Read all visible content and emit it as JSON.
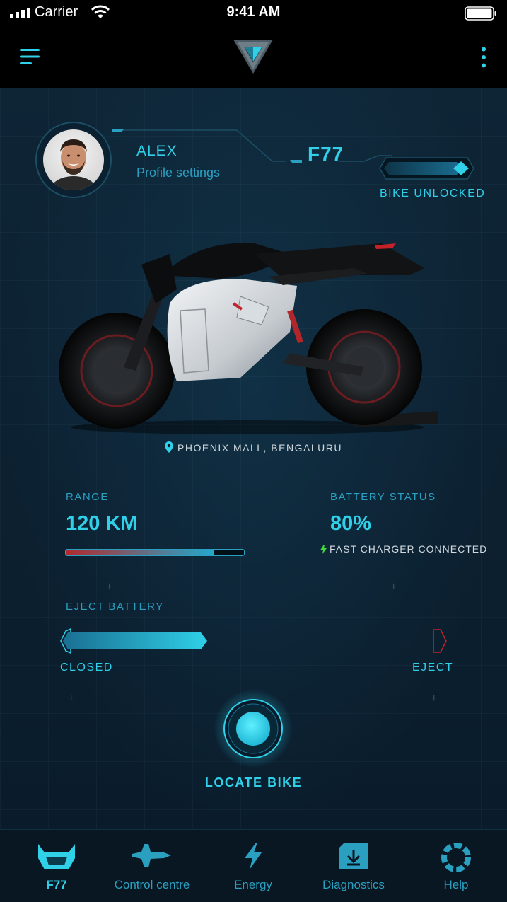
{
  "status_bar": {
    "carrier": "Carrier",
    "time": "9:41 AM"
  },
  "nav": {
    "menu_icon": "hamburger-icon",
    "logo_icon": "brand-logo",
    "more_icon": "more-vertical-icon"
  },
  "profile": {
    "name": "ALEX",
    "settings_link": "Profile settings"
  },
  "vehicle": {
    "model": "F77",
    "lock_status": "BIKE UNLOCKED",
    "lock_toggle_on": true,
    "location": "PHOENIX MALL, BENGALURU"
  },
  "range": {
    "label": "RANGE",
    "value": "120 KM",
    "fill_fraction": 0.83
  },
  "battery": {
    "label": "BATTERY STATUS",
    "value": "80%",
    "charger_status": "FAST CHARGER CONNECTED"
  },
  "eject": {
    "label": "EJECT BATTERY",
    "closed_label": "CLOSED",
    "eject_label": "EJECT"
  },
  "locate": {
    "label": "LOCATE BIKE"
  },
  "tabs": [
    {
      "label": "F77",
      "icon": "f77-bike-icon",
      "active": true
    },
    {
      "label": "Control centre",
      "icon": "jet-icon",
      "active": false
    },
    {
      "label": "Energy",
      "icon": "lightning-icon",
      "active": false
    },
    {
      "label": "Diagnostics",
      "icon": "download-icon",
      "active": false
    },
    {
      "label": "Help",
      "icon": "help-ring-icon",
      "active": false
    }
  ],
  "colors": {
    "accent": "#2fd0e8",
    "accent_dim": "#2a9fc0",
    "danger": "#b02a2e",
    "background": "#0a1c2b",
    "charger_green": "#3ddc3d"
  }
}
